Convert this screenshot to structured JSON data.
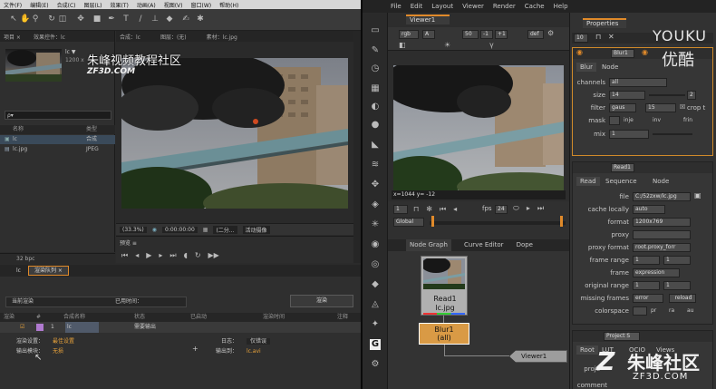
{
  "ae": {
    "menu": [
      "文件(F)",
      "编辑(E)",
      "合成(C)",
      "图层(L)",
      "效果(T)",
      "动画(A)",
      "视图(V)",
      "窗口(W)",
      "帮助(H)"
    ],
    "project_tabs": [
      "项目 ×",
      "效果控件：lc"
    ],
    "viewer_tabs": [
      "合成：lc",
      "图层：(无)",
      "素材：lc.jpg"
    ],
    "project_item_name": "lc ▼",
    "project_item_info": "1200 x",
    "search_placeholder": "ρ▾",
    "list_header": {
      "name": "名称",
      "type": "类型"
    },
    "items": [
      {
        "name": "lc",
        "type": "合成"
      },
      {
        "name": "lc.jpg",
        "type": "JPEG"
      }
    ],
    "bpc": "32 bpc",
    "viewer_bar": {
      "zoom": "(33.3%)",
      "timecode": "0:00:00:00",
      "res": "(二分...",
      "view": "活动摄像"
    },
    "preview_tab": "预览 ≡",
    "render_tabs": [
      "lc",
      "渲染队列 ×"
    ],
    "render_status_label": "当前渲染",
    "render_elapsed_label": "已用时间：",
    "render_button": "渲染",
    "render_columns": [
      "渲染",
      "#",
      "合成名称",
      "状态",
      "已启动",
      "渲染时间",
      "注释"
    ],
    "render_row": {
      "index": "1",
      "comp": "lc",
      "status": "需要输出"
    },
    "render_settings_label": "渲染设置：",
    "render_settings_value": "最佳设置",
    "output_module_label": "输出模块：",
    "output_module_value": "无损",
    "log_label": "日志：",
    "log_value": "仅错误",
    "output_to_label": "输出到：",
    "output_to_value": "lc.avi"
  },
  "nuke": {
    "menu": [
      "File",
      "Edit",
      "Layout",
      "Viewer",
      "Render",
      "Cache",
      "Help"
    ],
    "viewer_tab": "Viewer1",
    "viewer_fields": {
      "channel": "rgb",
      "alpha": "A",
      "zoom": "50",
      "frame_minus": "-1",
      "frame_plus": "+1",
      "label_def": "def"
    },
    "coords": "x=1044 y= -12",
    "fps_label": "fps",
    "fps_value": "24",
    "frame_value": "1",
    "global_label": "Global",
    "graph_tabs": [
      "Node Graph",
      "Curve Editor",
      "Dope"
    ],
    "read_node": {
      "name": "Read1",
      "file": "lc.jpg"
    },
    "blur_node": {
      "name": "Blur1",
      "sub": "(all)"
    },
    "viewer_node": "Viewer1",
    "properties_tab": "Properties",
    "properties_count": "10",
    "blur_panel": {
      "name": "Blur1",
      "tabs": [
        "Blur",
        "Node"
      ],
      "channels_label": "channels",
      "channels_value": "all",
      "size_label": "size",
      "size_value": "14",
      "size_right": "2",
      "filter_label": "filter",
      "filter_value": "gaus",
      "filter_quality": "15",
      "crop_label": "crop t",
      "mask_label": "mask",
      "mask_opts": [
        "inje",
        "inv",
        "frin"
      ],
      "mix_label": "mix",
      "mix_value": "1"
    },
    "read_panel": {
      "name": "Read1",
      "tabs": [
        "Read",
        "Sequence",
        "Node"
      ],
      "file_label": "file",
      "file_value": "C:/52zxw/lc.jpg",
      "cache_label": "cache locally",
      "cache_value": "auto",
      "format_label": "format",
      "format_value": "1200x769",
      "proxy_label": "proxy",
      "proxy_format_label": "proxy format",
      "proxy_format_value": "root.proxy_forr",
      "frame_range_label": "frame range",
      "frame_range_a": "1",
      "frame_range_b": "1",
      "frame_label": "frame",
      "frame_value": "expression",
      "orig_range_label": "original range",
      "orig_a": "1",
      "orig_b": "1",
      "missing_label": "missing frames",
      "missing_value": "error",
      "reload_label": "reload",
      "colorspace_label": "colorspace",
      "colorspace_opts": [
        "pr",
        "ra",
        "au"
      ]
    },
    "project_panel": {
      "name": "Project S",
      "tabs": [
        "Root",
        "LUT",
        "OCIO",
        "Views"
      ],
      "label_proj": "proje",
      "label_comment": "comment"
    }
  },
  "watermarks": {
    "site_cn": "朱峰视频教程社区",
    "site_url": "ZF3D.COM",
    "youku": "YOUKU",
    "youku_cn": "优酷",
    "bottom_cn": "朱峰社区",
    "bottom_url": "ZF3D.COM"
  }
}
